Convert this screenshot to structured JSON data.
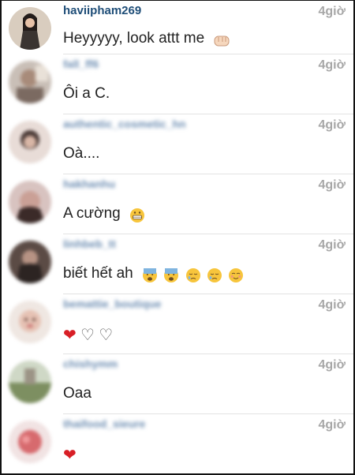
{
  "comments": [
    {
      "username": "haviipham269",
      "time": "4giờ",
      "message": "Heyyyyy, look attt me",
      "emojis": [
        "fist-emoji"
      ],
      "blurred": false
    },
    {
      "username": "fall_ff6",
      "time": "4giờ",
      "message": "Ôi a C.",
      "emojis": [],
      "blurred": true
    },
    {
      "username": "authentic_cosmetic_hn",
      "time": "4giờ",
      "message": "Oà....",
      "emojis": [],
      "blurred": true
    },
    {
      "username": "hakhanhu",
      "time": "4giờ",
      "message": "A cường",
      "emojis": [
        "grinning-emoji"
      ],
      "blurred": true
    },
    {
      "username": "linhbeb_tt",
      "time": "4giờ",
      "message": "biết hết ah",
      "emojis": [
        "fearful-emoji",
        "fearful-emoji",
        "sleepy-emoji",
        "sleepy-emoji",
        "blushing-emoji"
      ],
      "blurred": true
    },
    {
      "username": "bemattie_boutique",
      "time": "4giờ",
      "message": "",
      "emojis": [
        "red-heart-emoji",
        "white-heart-emoji",
        "white-heart-emoji"
      ],
      "blurred": true
    },
    {
      "username": "chishymm",
      "time": "4giờ",
      "message": "Oaa",
      "emojis": [],
      "blurred": true
    },
    {
      "username": "thaifood_sieure",
      "time": "4giờ",
      "message": "",
      "emojis": [
        "red-heart-emoji"
      ],
      "blurred": true
    }
  ],
  "colors": {
    "username": "#1f4e78",
    "username_blurred": "#6f8fb3",
    "time": "#a7a7a7",
    "divider": "#e3e3e3",
    "heart": "#d81f26"
  }
}
